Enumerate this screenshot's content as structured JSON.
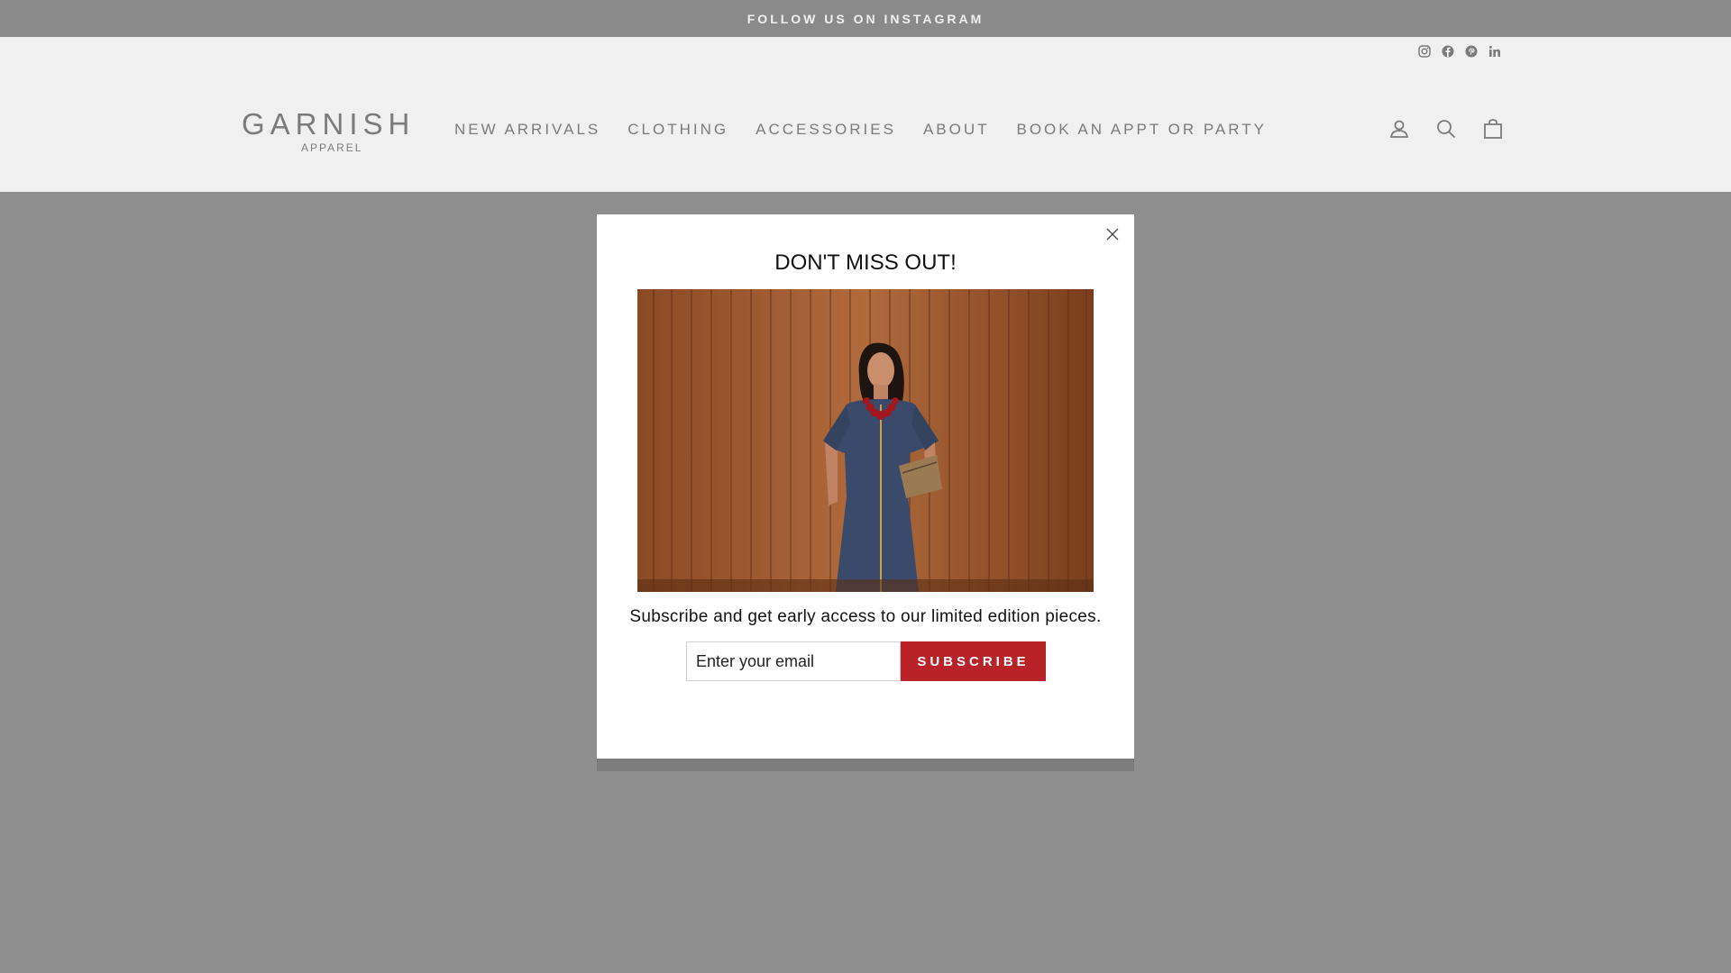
{
  "announcement": {
    "text": "FOLLOW US ON INSTAGRAM"
  },
  "social": {
    "icons": [
      "instagram-icon",
      "facebook-icon",
      "pinterest-icon",
      "linkedin-icon"
    ]
  },
  "logo": {
    "main": "GARNISH",
    "sub": "APPAREL"
  },
  "nav": {
    "items": [
      {
        "label": "NEW ARRIVALS"
      },
      {
        "label": "CLOTHING"
      },
      {
        "label": "ACCESSORIES"
      },
      {
        "label": "ABOUT"
      },
      {
        "label": "BOOK AN APPT OR PARTY"
      }
    ]
  },
  "header_icons": [
    "account-icon",
    "search-icon",
    "cart-icon"
  ],
  "modal": {
    "title": "DON'T MISS OUT!",
    "text": "Subscribe and get early access to our limited edition pieces.",
    "email_placeholder": "Enter your email",
    "subscribe_label": "SUBSCRIBE"
  },
  "colors": {
    "announcement_bg": "#8a8a8a",
    "header_bg": "#f0f0f0",
    "overlay_bg": "#8e8e8e",
    "accent": "#b8232a",
    "nav_text": "#7b7b7b"
  }
}
